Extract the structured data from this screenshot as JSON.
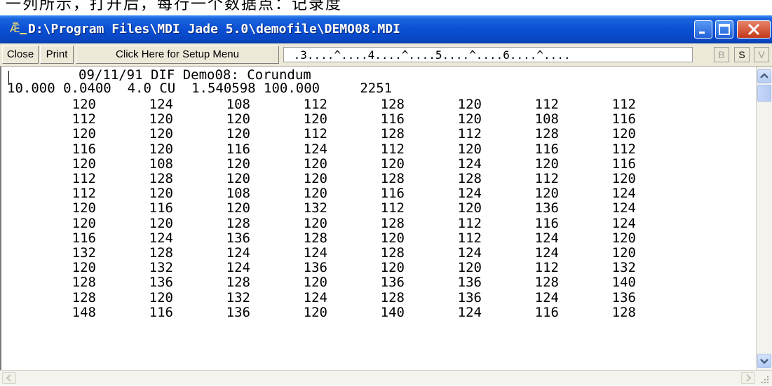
{
  "caption_text": "一列所示，打开后，每行一个数据点：记录度",
  "window": {
    "title": "D:\\Program Files\\MDI Jade 5.0\\demofile\\DEMO08.MDI",
    "accent_color": "#0a4fd2",
    "controls": {
      "minimize": "minimize",
      "maximize": "maximize",
      "close": "close"
    }
  },
  "toolbar": {
    "close_label": "Close",
    "print_label": "Print",
    "setup_label": "Click Here for Setup Menu",
    "ruler": " .3....^....4....^....5....^....6....^....",
    "b_label": "B",
    "s_label": "S",
    "v_label": "V"
  },
  "document": {
    "header_line1": "09/11/91 DIF Demo08: Corundum",
    "header_line2": "10.000 0.0400  4.0 CU  1.540598 100.000     2251",
    "rows": [
      [
        "120",
        "124",
        "108",
        "112",
        "128",
        "120",
        "112",
        "112"
      ],
      [
        "112",
        "120",
        "120",
        "120",
        "116",
        "120",
        "108",
        "116"
      ],
      [
        "120",
        "120",
        "120",
        "112",
        "128",
        "112",
        "128",
        "120"
      ],
      [
        "116",
        "120",
        "116",
        "124",
        "112",
        "120",
        "116",
        "112"
      ],
      [
        "120",
        "108",
        "120",
        "120",
        "120",
        "124",
        "120",
        "116"
      ],
      [
        "112",
        "128",
        "120",
        "120",
        "128",
        "128",
        "112",
        "120"
      ],
      [
        "112",
        "120",
        "108",
        "120",
        "116",
        "124",
        "120",
        "124"
      ],
      [
        "120",
        "116",
        "120",
        "132",
        "112",
        "120",
        "136",
        "124"
      ],
      [
        "120",
        "120",
        "128",
        "120",
        "128",
        "112",
        "116",
        "124"
      ],
      [
        "116",
        "124",
        "136",
        "128",
        "120",
        "112",
        "124",
        "120"
      ],
      [
        "132",
        "128",
        "124",
        "124",
        "128",
        "124",
        "124",
        "120"
      ],
      [
        "120",
        "132",
        "124",
        "136",
        "120",
        "120",
        "112",
        "132"
      ],
      [
        "128",
        "136",
        "128",
        "120",
        "136",
        "136",
        "128",
        "140"
      ],
      [
        "128",
        "120",
        "132",
        "124",
        "128",
        "136",
        "124",
        "136"
      ],
      [
        "148",
        "116",
        "136",
        "120",
        "140",
        "124",
        "116",
        "128"
      ]
    ]
  },
  "icons": {
    "app": "jade-app-icon",
    "scroll_up": "scroll-up-arrow-icon",
    "scroll_down": "scroll-down-arrow-icon",
    "scroll_left": "scroll-left-arrow-icon",
    "scroll_right": "scroll-right-arrow-icon",
    "resize": "size-grip-icon"
  }
}
